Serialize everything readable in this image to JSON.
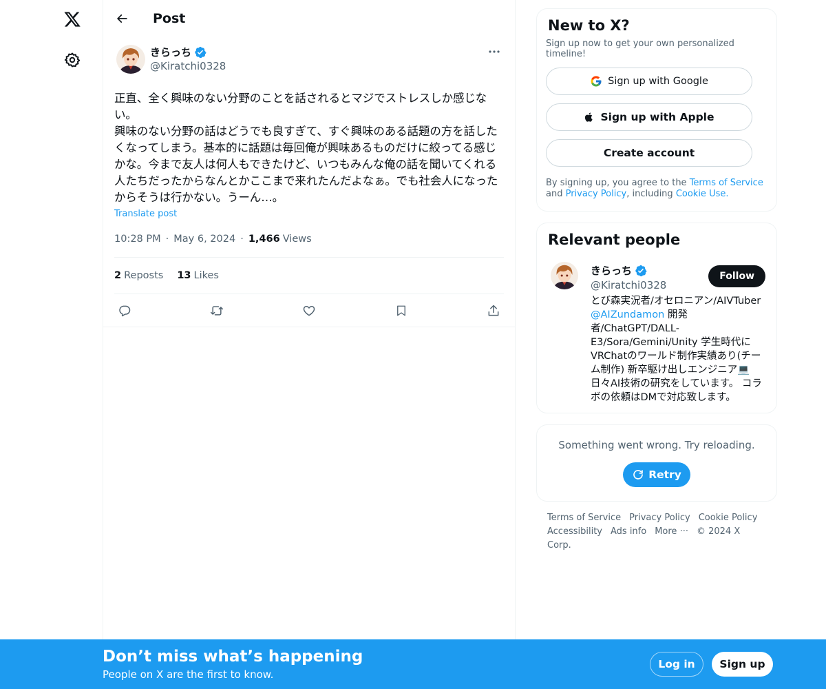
{
  "nav": {
    "logo_icon": "x-logo-icon",
    "settings_icon": "gear-icon"
  },
  "header": {
    "title": "Post",
    "back_icon": "arrow-left-icon"
  },
  "post": {
    "author": {
      "display_name": "きらっち",
      "handle": "@Kiratchi0328",
      "verified": true
    },
    "text": "正直、全く興味のない分野のことを話されるとマジでストレスしか感じない。\n興味のない分野の話はどうでも良すぎて、すぐ興味のある話題の方を話したくなってしまう。基本的に話題は毎回俺が興味あるものだけに絞ってる感じかな。今まで友人は何人もできたけど、いつもみんな俺の話を聞いてくれる人たちだったからなんとかここまで来れたんだよなぁ。でも社会人になったからそうは行かない。うーん…。",
    "translate_label": "Translate post",
    "time": "10:28 PM",
    "date": "May 6, 2024",
    "views_count": "1,466",
    "views_label": "Views",
    "reposts_count": "2",
    "reposts_label": "Reposts",
    "likes_count": "13",
    "likes_label": "Likes"
  },
  "signup_card": {
    "title": "New to X?",
    "subtitle": "Sign up now to get your own personalized timeline!",
    "google_label": "Sign up with Google",
    "apple_label": "Sign up with Apple",
    "create_label": "Create account",
    "legal_prefix": "By signing up, you agree to the ",
    "terms_link": "Terms of Service",
    "legal_and": " and ",
    "privacy_link": "Privacy Policy",
    "legal_including": ", including ",
    "cookie_link": "Cookie Use."
  },
  "relevant": {
    "title": "Relevant people",
    "person": {
      "display_name": "きらっち",
      "handle": "@Kiratchi0328",
      "follow_label": "Follow",
      "bio_part1": "とび森実況者/オセロニアン/AIVTuber ",
      "bio_mention": "@AIZundamon",
      "bio_part2": " 開発者/ChatGPT/DALL-E3/Sora/Gemini/Unity 学生時代にVRChatのワールド制作実績あり(チーム制作) 新卒駆け出しエンジニア💻 日々AI技術の研究をしています。 コラボの依頼はDMで対応致します。"
    }
  },
  "error_card": {
    "message": "Something went wrong. Try reloading.",
    "retry_label": "Retry"
  },
  "footer": {
    "links": [
      "Terms of Service",
      "Privacy Policy",
      "Cookie Policy",
      "Accessibility",
      "Ads info",
      "More ···"
    ],
    "copyright": "© 2024 X Corp."
  },
  "bottom_bar": {
    "title": "Don’t miss what’s happening",
    "subtitle": "People on X are the first to know.",
    "login_label": "Log in",
    "signup_label": "Sign up"
  },
  "colors": {
    "accent": "#1d9bf0",
    "text": "#0f1419",
    "muted": "#536471",
    "border": "#eff3f4"
  }
}
